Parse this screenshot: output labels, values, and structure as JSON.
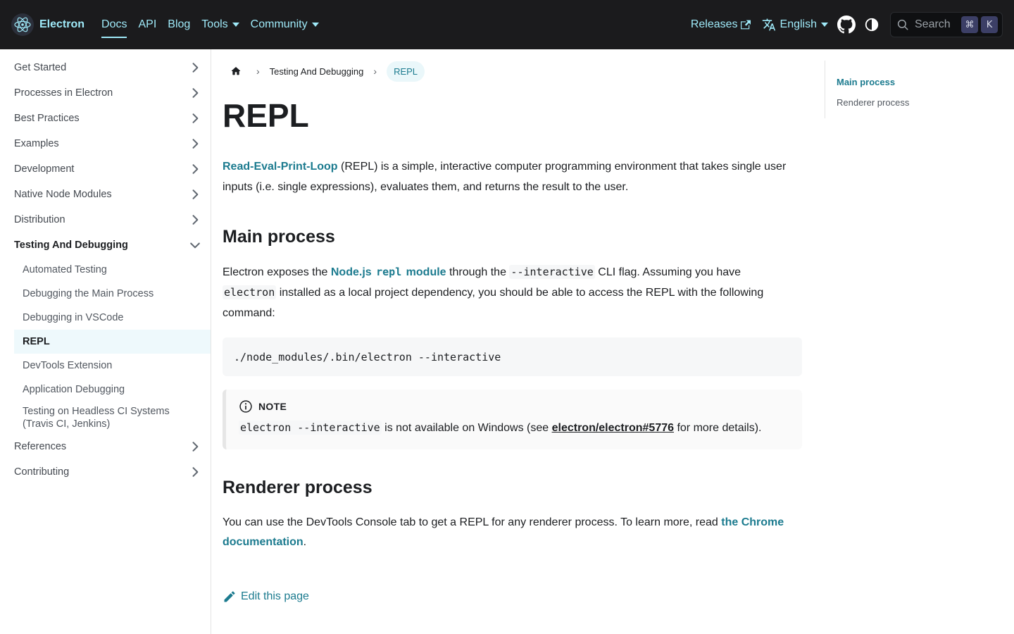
{
  "navbar": {
    "brand": "Electron",
    "links": [
      "Docs",
      "API",
      "Blog",
      "Tools",
      "Community"
    ],
    "releases": "Releases",
    "language": "English",
    "search_placeholder": "Search",
    "kbd_cmd": "⌘",
    "kbd_k": "K"
  },
  "sidebar": {
    "top_items": [
      "Get Started",
      "Processes in Electron",
      "Best Practices",
      "Examples",
      "Development",
      "Native Node Modules",
      "Distribution"
    ],
    "open_section": "Testing And Debugging",
    "sub_items": [
      "Automated Testing",
      "Debugging the Main Process",
      "Debugging in VSCode",
      "REPL",
      "DevTools Extension",
      "Application Debugging",
      "Testing on Headless CI Systems (Travis CI, Jenkins)"
    ],
    "bottom_items": [
      "References",
      "Contributing"
    ]
  },
  "breadcrumb": {
    "parent": "Testing And Debugging",
    "current": "REPL"
  },
  "page": {
    "title": "REPL",
    "intro_link": "Read-Eval-Print-Loop",
    "intro_rest_1": " (REPL) is a simple, interactive computer programming environment that takes single user",
    "intro_rest_2": "inputs (i.e. single expressions), evaluates them, and returns the result to the user.",
    "h2_main": "Main process",
    "main_p_1a": "Electron exposes the ",
    "main_link_a": "Node.js ",
    "main_link_code": "repl",
    "main_link_b": " module",
    "main_p_1b": " through the ",
    "main_code_flag": "--interactive",
    "main_p_1c": " CLI flag. Assuming you have",
    "main_code_electron": "electron",
    "main_p_2": " installed as a local project dependency, you should be able to access the REPL with the following",
    "main_p_3": "command:",
    "code_block": "./node_modules/.bin/electron --interactive",
    "note_label": "NOTE",
    "note_code": "electron --interactive",
    "note_text_a": " is not available on Windows (see ",
    "note_link": "electron/electron#5776",
    "note_text_b": " for more details).",
    "h2_renderer": "Renderer process",
    "renderer_p_1": "You can use the DevTools Console tab to get a REPL for any renderer process. To learn more, read ",
    "renderer_link_1": "the Chrome",
    "renderer_link_2": "documentation",
    "renderer_end": ".",
    "edit_label": "Edit this page"
  },
  "toc": {
    "items": [
      "Main process",
      "Renderer process"
    ]
  },
  "colors": {
    "navbar_bg": "#1b1b1d",
    "nav_accent": "#9feaf9",
    "link": "#1c7b8f"
  }
}
